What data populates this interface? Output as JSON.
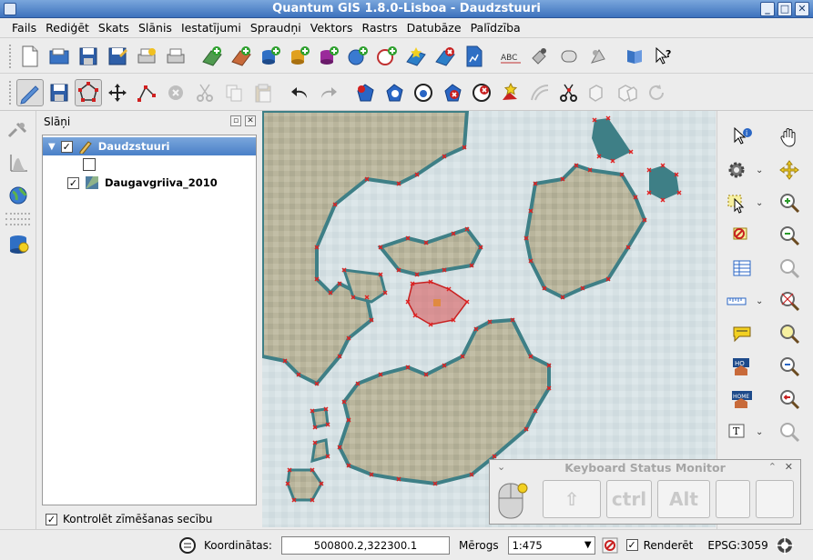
{
  "window": {
    "title": "Quantum GIS 1.8.0-Lisboa - Daudzstuuri"
  },
  "menu": [
    "Fails",
    "Rediģēt",
    "Skats",
    "Slānis",
    "Iestatījumi",
    "Spraudņi",
    "Vektors",
    "Rastrs",
    "Datubāze",
    "Palīdzība"
  ],
  "toolbar1": [
    "new-project-icon",
    "open-project-icon",
    "save-project-icon",
    "save-as-icon",
    "print-composer-icon",
    "print-icon",
    "add-raster-icon",
    "add-wms-icon",
    "add-postgis-icon",
    "add-spatialite-icon",
    "add-mssql-icon",
    "add-wfs-icon",
    "add-delimited-icon",
    "new-vector-icon",
    "remove-layer-icon",
    "add-wcs-icon",
    "label-icon",
    "plugin-icon",
    "plugin2-icon",
    "plugin3-icon",
    "help-book-icon",
    "whats-this-icon"
  ],
  "toolbar2": [
    "toggle-editing-icon",
    "save-edits-icon",
    "node-tool-icon",
    "move-feature-icon",
    "add-vertex-icon",
    "delete-selected-icon",
    "cut-icon",
    "copy-icon",
    "paste-icon",
    "undo-icon",
    "redo-icon",
    "add-ring-icon",
    "add-part-icon",
    "fill-ring-icon",
    "delete-ring-icon",
    "delete-part-icon",
    "reshape-icon",
    "offset-curve-icon",
    "split-icon",
    "merge-icon",
    "merge-attrs-icon",
    "rotate-icon"
  ],
  "layers_panel": {
    "title": "Slāņi",
    "layers": [
      {
        "name": "Daudzstuuri",
        "checked": true,
        "selected": true
      },
      {
        "name": "Daugavgriiva_2010",
        "checked": true,
        "selected": false
      }
    ],
    "render_order_label": "Kontrolēt zīmēšanas secību",
    "render_order_checked": true
  },
  "keyboard_monitor": {
    "title": "Keyboard Status Monitor",
    "keys": [
      "⇧",
      "ctrl",
      "Alt",
      "",
      ""
    ]
  },
  "status": {
    "coord_label": "Koordinātas:",
    "coord_value": "500800.2,322300.1",
    "scale_label": "Mērogs",
    "scale_value": "1:475",
    "render_label": "Renderēt",
    "render_checked": true,
    "crs": "EPSG:3059"
  },
  "colors": {
    "title_blue": "#4a80c8",
    "land": "#b7b39a",
    "water": "#d8e3e6",
    "teal": "#3e7f86",
    "vertex": "#e02020",
    "selection": "#d95050"
  }
}
